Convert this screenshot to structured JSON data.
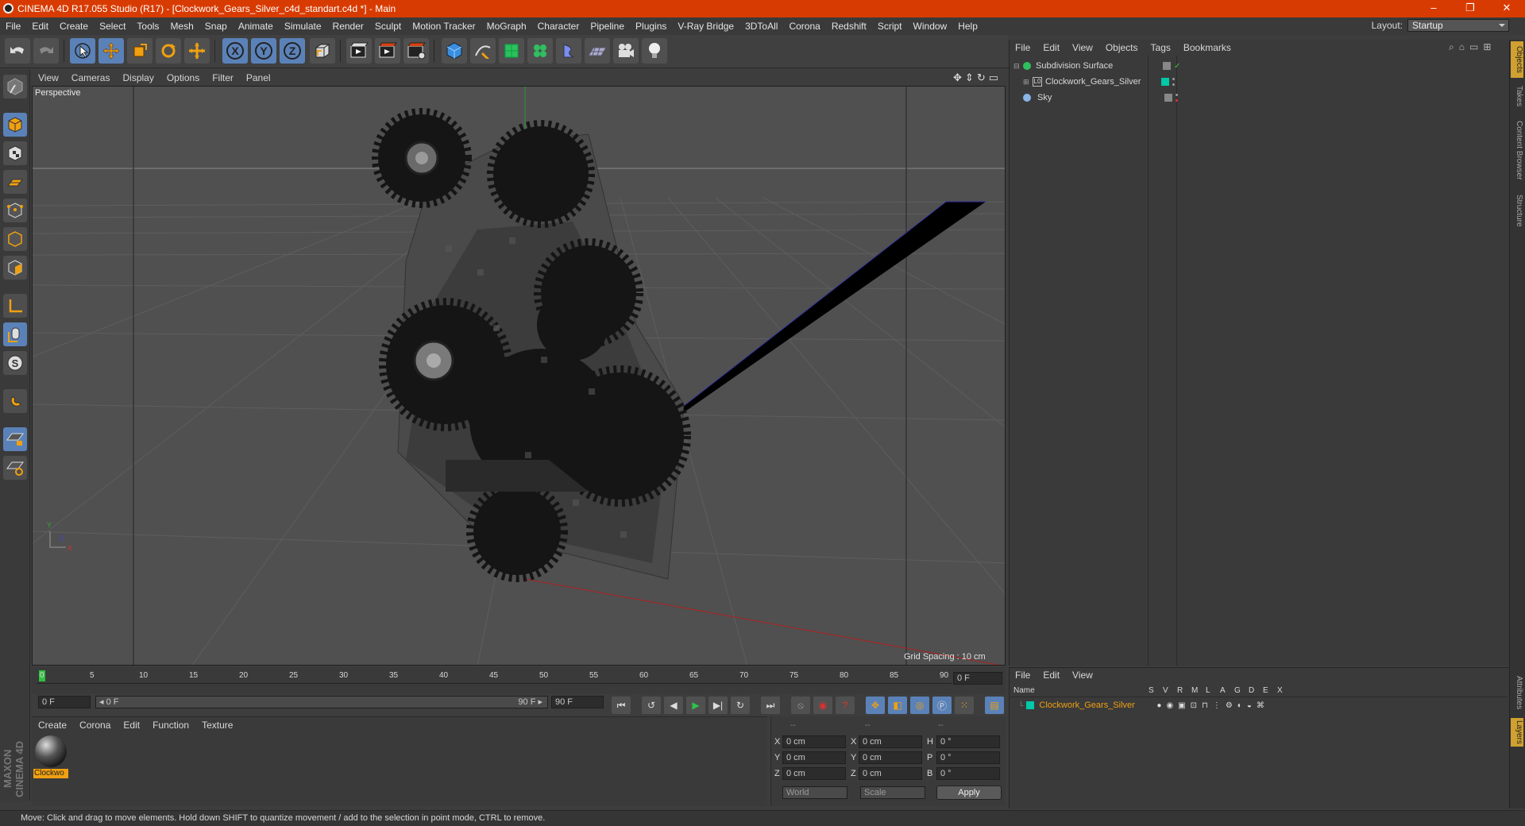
{
  "window": {
    "title": "CINEMA 4D R17.055 Studio (R17) - [Clockwork_Gears_Silver_c4d_standart.c4d *] - Main",
    "controls": [
      "–",
      "❐",
      "✕"
    ]
  },
  "menubar": {
    "items": [
      "File",
      "Edit",
      "Create",
      "Select",
      "Tools",
      "Mesh",
      "Snap",
      "Animate",
      "Simulate",
      "Render",
      "Sculpt",
      "Motion Tracker",
      "MoGraph",
      "Character",
      "Pipeline",
      "Plugins",
      "V-Ray Bridge",
      "3DToAll",
      "Corona",
      "Redshift",
      "Script",
      "Window",
      "Help"
    ],
    "layout_label": "Layout:",
    "layout_value": "Startup"
  },
  "toolbar": {
    "icons": [
      "undo-icon",
      "redo-icon",
      "select-arrow-icon",
      "move-icon",
      "scale-icon",
      "rotate-icon",
      "live-select-icon",
      "x-axis-icon",
      "y-axis-icon",
      "z-axis-icon",
      "world-coord-icon",
      "render-view-icon",
      "render-picture-viewer-icon",
      "render-settings-icon",
      "cube-primitive-icon",
      "spline-pen-icon",
      "subdivision-icon",
      "cloner-icon",
      "deformer-icon",
      "floor-icon",
      "camera-icon",
      "light-icon"
    ],
    "axis_labels": [
      "X",
      "Y",
      "Z"
    ]
  },
  "viewport": {
    "menu": [
      "View",
      "Cameras",
      "Display",
      "Options",
      "Filter",
      "Panel"
    ],
    "label": "Perspective",
    "grid_spacing": "Grid Spacing : 10 cm"
  },
  "timeline": {
    "ticks": [
      "0",
      "5",
      "10",
      "15",
      "20",
      "25",
      "30",
      "35",
      "40",
      "45",
      "50",
      "55",
      "60",
      "65",
      "70",
      "75",
      "80",
      "85",
      "90"
    ],
    "current_frame": "0 F",
    "start_field": "0 F",
    "range_start": "◂ 0 F",
    "range_end": "90 F ▸",
    "end_field": "90 F"
  },
  "material_panel": {
    "menu": [
      "Create",
      "Corona",
      "Edit",
      "Function",
      "Texture"
    ],
    "material_name": "Clockwo"
  },
  "coordinates": {
    "headers": [
      "--",
      "--",
      "--"
    ],
    "rows": [
      {
        "a": "X",
        "av": "0 cm",
        "b": "X",
        "bv": "0 cm",
        "c": "H",
        "cv": "0 °"
      },
      {
        "a": "Y",
        "av": "0 cm",
        "b": "Y",
        "bv": "0 cm",
        "c": "P",
        "cv": "0 °"
      },
      {
        "a": "Z",
        "av": "0 cm",
        "b": "Z",
        "bv": "0 cm",
        "c": "B",
        "cv": "0 °"
      }
    ],
    "mode": "World",
    "scale": "Scale",
    "apply": "Apply"
  },
  "objects_panel": {
    "menu": [
      "File",
      "Edit",
      "View",
      "Objects",
      "Tags",
      "Bookmarks"
    ],
    "items": [
      {
        "name": "Subdivision Surface",
        "indent": 0
      },
      {
        "name": "Clockwork_Gears_Silver",
        "indent": 1
      },
      {
        "name": "Sky",
        "indent": 0
      }
    ]
  },
  "layers_panel": {
    "menu": [
      "File",
      "Edit",
      "View"
    ],
    "header_name": "Name",
    "columns": [
      "S",
      "V",
      "R",
      "M",
      "L",
      "A",
      "G",
      "D",
      "E",
      "X"
    ],
    "layer_name": "Clockwork_Gears_Silver",
    "layer_color": "#00c8a8"
  },
  "right_tabs": [
    "Objects",
    "Takes",
    "Content Browser",
    "Structure",
    "Attributes",
    "Layers"
  ],
  "status": "Move: Click and drag to move elements. Hold down SHIFT to quantize movement / add to the selection in point mode, CTRL to remove.",
  "brand": "MAXON CINEMA 4D",
  "colors": {
    "accent": "#5b82b8",
    "title": "#d83b01",
    "highlight": "#f0a010"
  }
}
